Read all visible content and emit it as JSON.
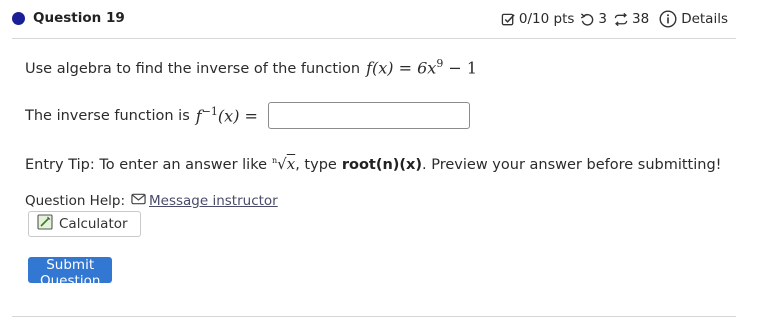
{
  "question": {
    "title": "Question 19",
    "score": "0/10 pts",
    "attempts": "3",
    "submissions": "38",
    "details_label": "Details"
  },
  "prompt": {
    "text": "Use algebra to find the inverse of the function",
    "function_lhs": "f(x)",
    "equals": "=",
    "coef": "6x",
    "exponent": "9",
    "rest": "− 1"
  },
  "answer": {
    "label": "The inverse function is",
    "math_f": "f",
    "math_exp": "−1",
    "math_arg": "(x)",
    "equals": "=",
    "value": ""
  },
  "tip": {
    "prefix": "Entry Tip: To enter an answer like",
    "root_index": "n",
    "root_radicand": "x",
    "middle": ", type",
    "code": "root(n)(x)",
    "suffix": ". Preview your answer before submitting!"
  },
  "help": {
    "label": "Question Help:",
    "message_link": "Message instructor",
    "calculator": "Calculator"
  },
  "submit_label": "Submit Question",
  "colors": {
    "accent_dot": "#1a1f96",
    "submit_bg": "#3277d2"
  },
  "icons": {
    "score": "checkbox-edit-icon",
    "attempts": "retry-icon",
    "submissions": "repeat-icon",
    "details": "info-icon",
    "message": "envelope-icon",
    "calculator": "calculator-icon"
  }
}
